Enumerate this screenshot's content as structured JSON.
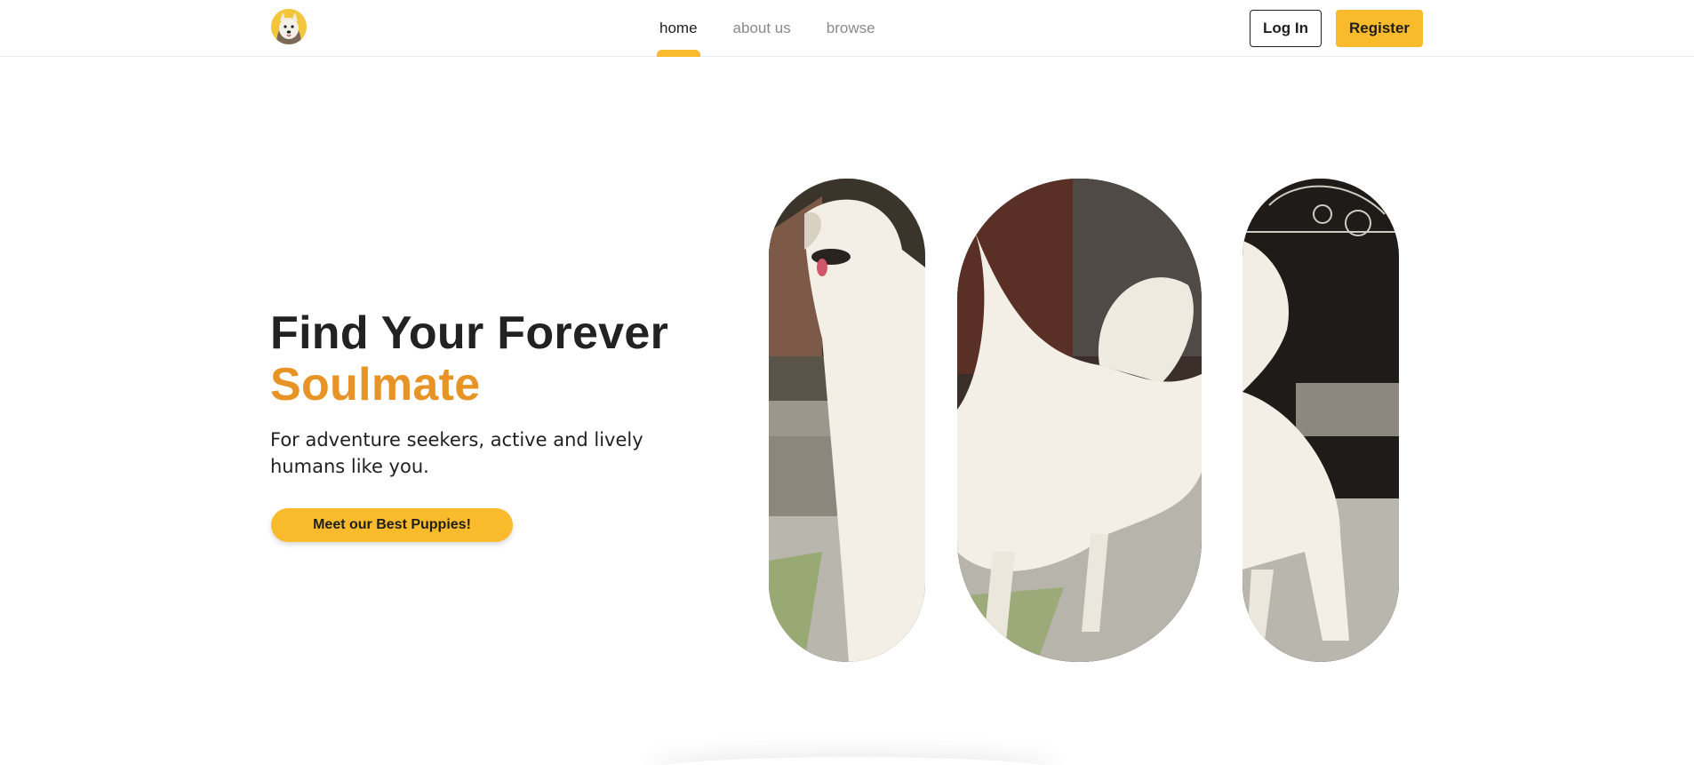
{
  "header": {
    "logo_icon": "dog-logo-icon",
    "nav": [
      {
        "label": "home",
        "active": true
      },
      {
        "label": "about us",
        "active": false
      },
      {
        "label": "browse",
        "active": false
      }
    ],
    "login_label": "Log In",
    "register_label": "Register"
  },
  "hero": {
    "title_line1": "Find Your Forever",
    "title_line2": "Soulmate",
    "subtitle": "For adventure seekers, active and lively humans like you.",
    "cta_label": "Meet our Best Puppies!"
  },
  "gallery": {
    "images": [
      {
        "name": "dog-image-head",
        "description": ""
      },
      {
        "name": "dog-image-body",
        "description": ""
      },
      {
        "name": "dog-image-tail",
        "description": ""
      }
    ]
  },
  "colors": {
    "accent": "#f9bb2c",
    "title_accent": "#e89325",
    "text": "#222222"
  }
}
